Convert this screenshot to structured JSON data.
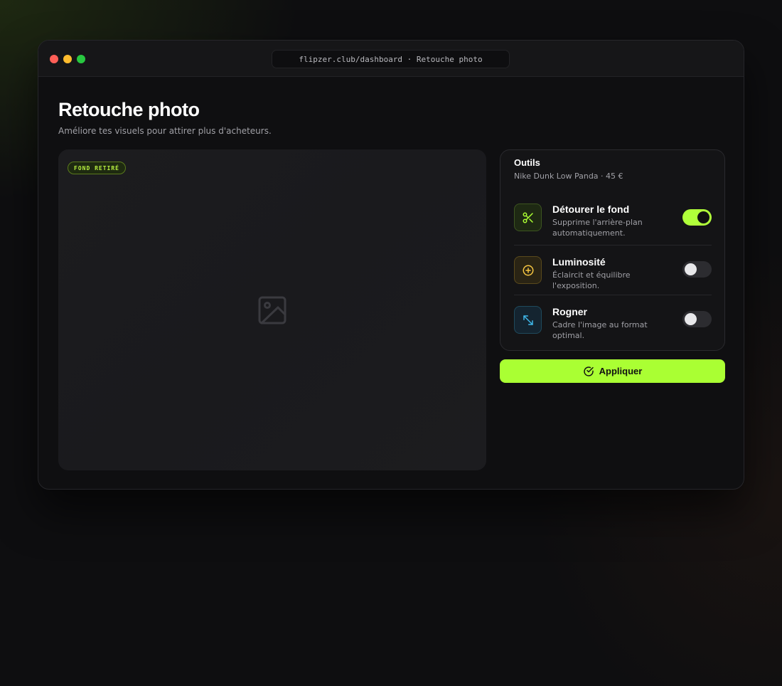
{
  "browser": {
    "url": "flipzer.club/dashboard · Retouche photo"
  },
  "page": {
    "title": "Retouche photo",
    "subtitle": "Améliore tes visuels pour attirer plus d'acheteurs."
  },
  "preview": {
    "badge": "FOND RETIRÉ",
    "placeholder_icon": "image-icon"
  },
  "tools_panel": {
    "title": "Outils",
    "product": "Nike Dunk Low Panda · 45 €",
    "tools": [
      {
        "name": "Détourer le fond",
        "desc": "Supprime l'arrière-plan automatiquement.",
        "icon": "scissors-icon",
        "enabled": true
      },
      {
        "name": "Luminosité",
        "desc": "Éclaircit et équilibre l'exposition.",
        "icon": "plus-circle-icon",
        "enabled": false
      },
      {
        "name": "Rogner",
        "desc": "Cadre l'image au format optimal.",
        "icon": "resize-arrows-icon",
        "enabled": false
      }
    ]
  },
  "actions": {
    "apply_label": "Appliquer",
    "apply_icon": "check-circle-icon"
  },
  "colors": {
    "accent": "#aaff33",
    "luminosity_icon": "#f5c542",
    "crop_icon": "#3fb6e8"
  }
}
